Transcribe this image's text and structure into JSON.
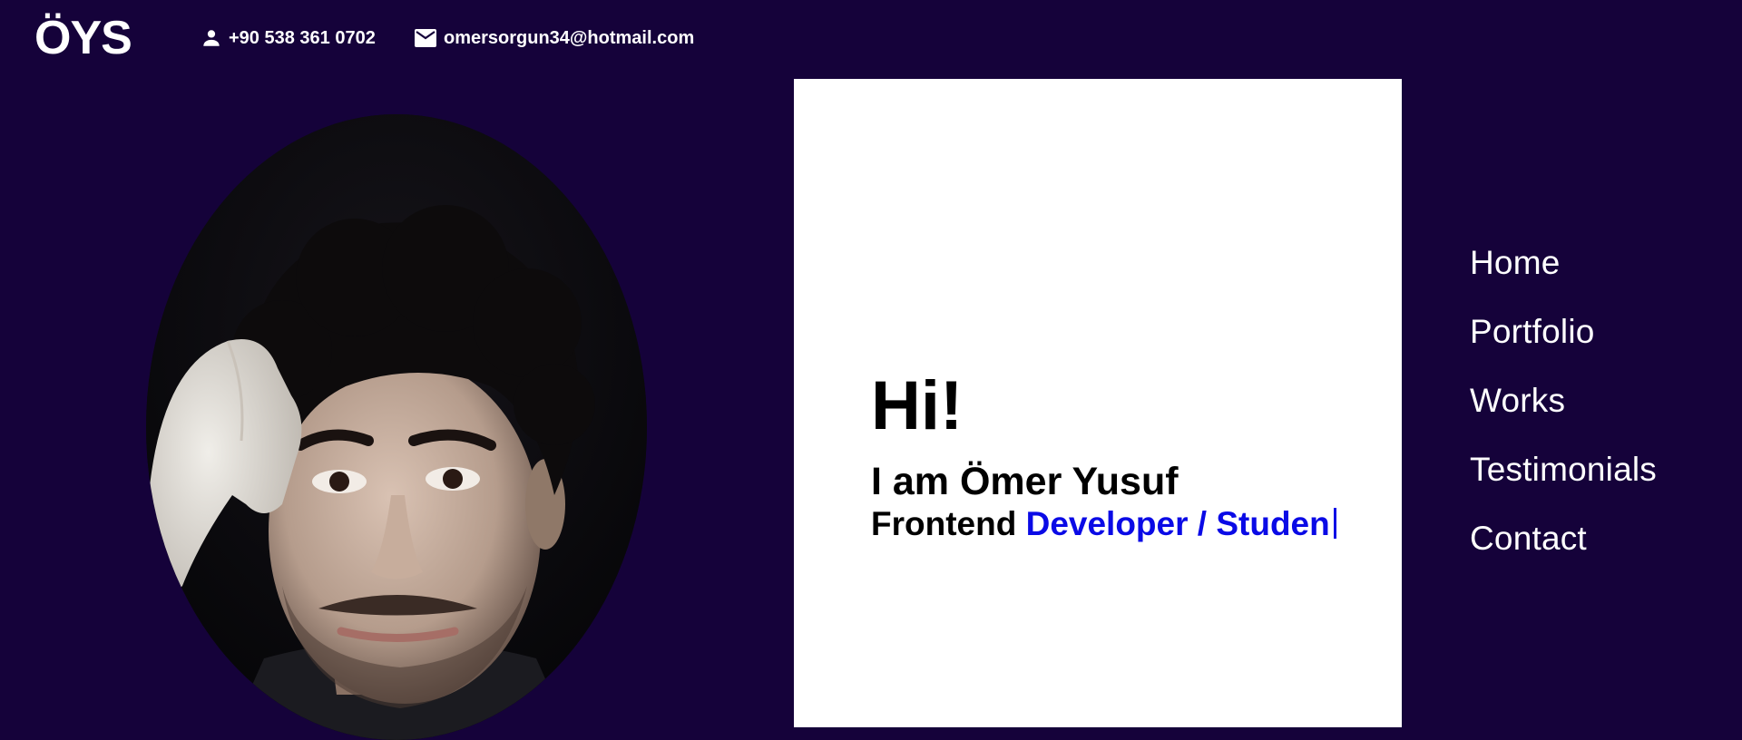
{
  "header": {
    "logo": "ÖYS",
    "phone": "+90 538 361 0702",
    "email": "omersorgun34@hotmail.com",
    "phone_icon": "person-icon",
    "email_icon": "mail-icon"
  },
  "hero": {
    "greeting": "Hi!",
    "name_line": "I am Ömer Yusuf",
    "role_static": "Frontend",
    "role_typed": "Developer / Studen"
  },
  "nav": {
    "items": [
      {
        "label": "Home"
      },
      {
        "label": "Portfolio"
      },
      {
        "label": "Works"
      },
      {
        "label": "Testimonials"
      },
      {
        "label": "Contact"
      }
    ]
  },
  "colors": {
    "background": "#15023a",
    "card": "#ffffff",
    "accent": "#0a0ae6"
  }
}
